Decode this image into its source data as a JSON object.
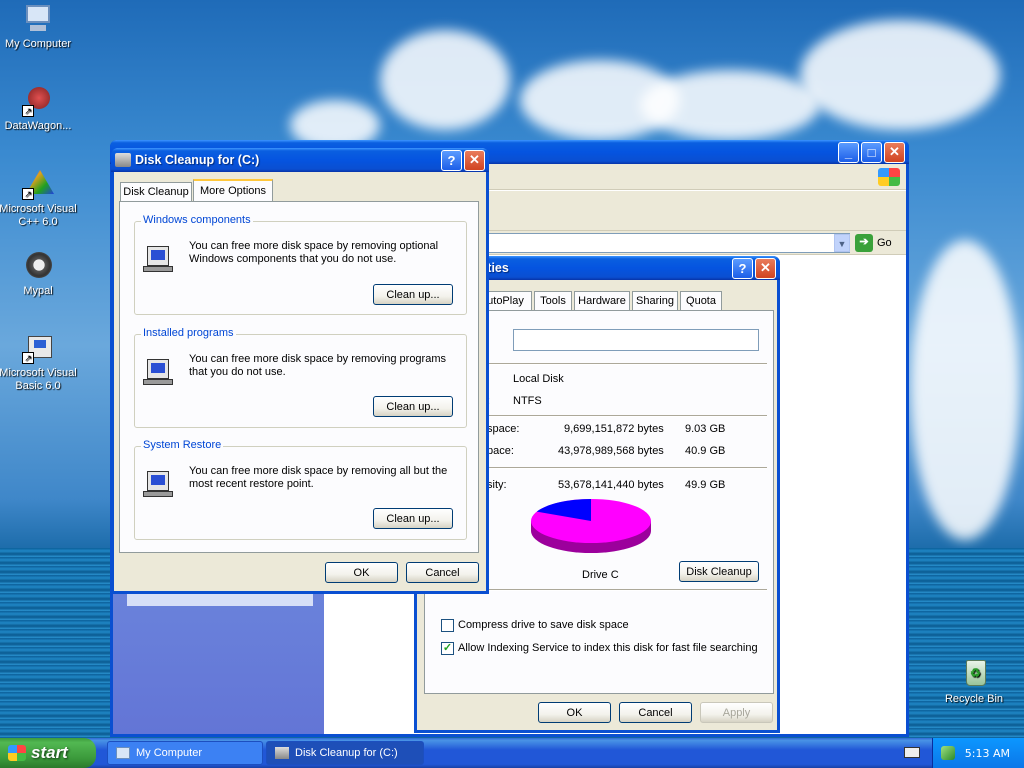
{
  "desktop": {
    "icons": [
      {
        "label": "My Computer",
        "icon": "my-computer-icon"
      },
      {
        "label": "DataWagon...",
        "icon": "datawagon-icon"
      },
      {
        "label": "Microsoft Visual C++ 6.0",
        "icon": "visual-cpp-icon"
      },
      {
        "label": "Mypal",
        "icon": "mypal-icon"
      },
      {
        "label": "Microsoft Visual Basic 6.0",
        "icon": "visual-basic-icon"
      },
      {
        "label": "Recycle Bin",
        "icon": "recycle-bin-icon"
      }
    ]
  },
  "explorer": {
    "go_label": "Go"
  },
  "properties": {
    "title": "(C:) Properties",
    "tabs": [
      "utoPlay",
      "Tools",
      "Hardware",
      "Sharing",
      "Quota"
    ],
    "type_value": "Local Disk",
    "fs_label": ":",
    "fs_value": "NTFS",
    "used_label": "space:",
    "used_bytes": "9,699,151,872 bytes",
    "used_gb": "9.03 GB",
    "free_label": "pace:",
    "free_bytes": "43,978,989,568 bytes",
    "free_gb": "40.9 GB",
    "cap_label": "sity:",
    "cap_bytes": "53,678,141,440 bytes",
    "cap_gb": "49.9 GB",
    "drive_label": "Drive C",
    "disk_cleanup_button": "Disk Cleanup",
    "compress_label": "Compress drive to save disk space",
    "compress_checked": false,
    "indexing_label": "Allow Indexing Service to index this disk for fast file searching",
    "indexing_checked": true,
    "ok_button": "OK",
    "cancel_button": "Cancel",
    "apply_button": "Apply",
    "used_fraction": 0.18,
    "colors": {
      "used": "#0000ff",
      "free": "#ff00ff"
    }
  },
  "cleanup": {
    "title": "Disk Cleanup for  (C:)",
    "tabs": [
      "Disk Cleanup",
      "More Options"
    ],
    "active_tab": "More Options",
    "groups": [
      {
        "title": "Windows components",
        "desc": "You can free more disk space by removing optional Windows components that you do not use.",
        "button": "Clean up..."
      },
      {
        "title": "Installed programs",
        "desc": "You can free more disk space by removing programs that you do not use.",
        "button": "Clean up..."
      },
      {
        "title": "System Restore",
        "desc": "You can free more disk space by removing all but the most recent restore point.",
        "button": "Clean up..."
      }
    ],
    "ok_button": "OK",
    "cancel_button": "Cancel"
  },
  "taskbar": {
    "start_label": "start",
    "tasks": [
      "My Computer",
      "Disk Cleanup for  (C:)"
    ],
    "clock": "5:13 AM"
  }
}
